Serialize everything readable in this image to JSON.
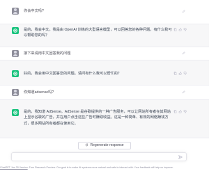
{
  "conversation": [
    {
      "role": "user",
      "text": "你会中文吗?"
    },
    {
      "role": "assistant",
      "text": "是的，我会中文。我是由 OpenAI 训练的大型语言模型，可以回答您的各种问题。有什么我可以帮助您的吗？"
    },
    {
      "role": "user",
      "text": "接下来请用中文回答我的问题"
    },
    {
      "role": "assistant",
      "text": "好的，我会用中文回答您的问题。请问有什么我可以帮忙的？"
    },
    {
      "role": "user",
      "text": "你知道adsense吗?"
    },
    {
      "role": "assistant",
      "text": "是的，我知道 AdSense。AdSense 是谷歌提供的一种广告服务，可以让网站所有者在其网站上显示谷歌的广告，并在用户点击这些广告时赚取收益。这是一种简单、有效的网络赚钱方式，很多网站所有者都在使用它。"
    }
  ],
  "regenerate_label": "Regenerate response",
  "footer": {
    "version_link": "ChatGPT Jan 30 Version",
    "text": ". Free Research Preview. Our goal is to make AI systems more natural and safe to interact with. Your feedback will help us improve."
  },
  "colors": {
    "assistant_bg": "#f7f7f8",
    "bot_avatar": "#19c37d",
    "user_avatar": "#8e8e9a"
  },
  "icons": [
    "user-avatar-icon",
    "chatgpt-logo-icon",
    "edit-icon",
    "copy-icon",
    "thumbs-up-icon",
    "thumbs-down-icon",
    "refresh-icon",
    "send-icon"
  ]
}
